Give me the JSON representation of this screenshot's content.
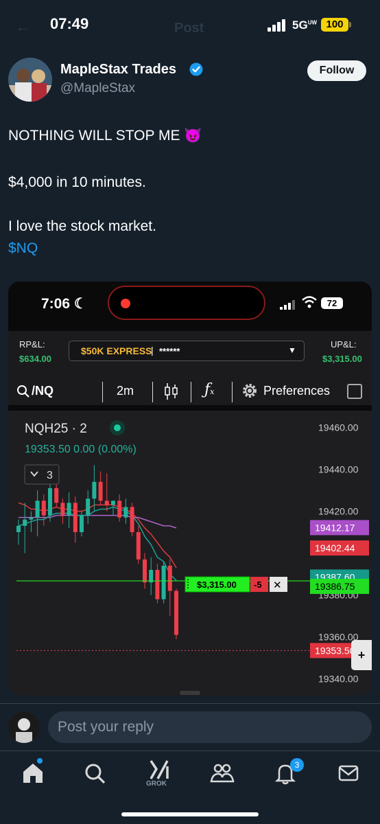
{
  "status_bar": {
    "time": "07:49",
    "network": "5G",
    "network_sup": "UW",
    "battery": "100",
    "ghost_title": "Post"
  },
  "author": {
    "name": "MapleStax Trades",
    "handle": "@MapleStax",
    "follow_label": "Follow"
  },
  "tweet": {
    "line1": "NOTHING WILL STOP ME 😈",
    "line2": "$4,000 in 10 minutes.",
    "line3": "I love the stock market.",
    "cashtag": "$NQ"
  },
  "media": {
    "status_bar": {
      "time": "7:06",
      "battery": "72"
    },
    "trade_bar": {
      "rp_label": "RP&L:",
      "rp_value": "$634.00",
      "account_name": "$50K EXPRESS",
      "account_sep": "|",
      "account_mask": "******",
      "up_label": "UP&L:",
      "up_value": "$3,315.00"
    },
    "toolbar": {
      "symbol": "/NQ",
      "interval": "2m",
      "preferences": "Preferences"
    },
    "chart": {
      "instrument": "NQH25 · 2",
      "quote": "19353.50  0.00 (0.00%)",
      "indicator_count": "3",
      "position": {
        "pnl": "$3,315.00",
        "qty": "-5",
        "close": "✕"
      },
      "plus": "+"
    }
  },
  "chart_data": {
    "type": "candlestick",
    "ylim": [
      19332,
      19468
    ],
    "y_ticks": [
      19460,
      19440,
      19420,
      19380,
      19360,
      19340
    ],
    "y_tick_labels": [
      "19460.00",
      "19440.00",
      "19420.00",
      "19380.00",
      "19360.00",
      "19340.00"
    ],
    "candles": [
      {
        "o": 19410,
        "h": 19416,
        "l": 19404,
        "c": 19413
      },
      {
        "o": 19413,
        "h": 19424,
        "l": 19400,
        "c": 19416
      },
      {
        "o": 19416,
        "h": 19420,
        "l": 19410,
        "c": 19417
      },
      {
        "o": 19417,
        "h": 19430,
        "l": 19408,
        "c": 19425
      },
      {
        "o": 19425,
        "h": 19428,
        "l": 19413,
        "c": 19418
      },
      {
        "o": 19418,
        "h": 19436,
        "l": 19415,
        "c": 19431
      },
      {
        "o": 19431,
        "h": 19435,
        "l": 19422,
        "c": 19424
      },
      {
        "o": 19424,
        "h": 19426,
        "l": 19414,
        "c": 19418
      },
      {
        "o": 19418,
        "h": 19429,
        "l": 19412,
        "c": 19424
      },
      {
        "o": 19424,
        "h": 19427,
        "l": 19405,
        "c": 19410
      },
      {
        "o": 19410,
        "h": 19420,
        "l": 19408,
        "c": 19418
      },
      {
        "o": 19418,
        "h": 19430,
        "l": 19414,
        "c": 19426
      },
      {
        "o": 19426,
        "h": 19442,
        "l": 19420,
        "c": 19434
      },
      {
        "o": 19434,
        "h": 19439,
        "l": 19423,
        "c": 19425
      },
      {
        "o": 19425,
        "h": 19438,
        "l": 19420,
        "c": 19423
      },
      {
        "o": 19423,
        "h": 19425,
        "l": 19418,
        "c": 19425
      },
      {
        "o": 19425,
        "h": 19428,
        "l": 19415,
        "c": 19417
      },
      {
        "o": 19417,
        "h": 19426,
        "l": 19414,
        "c": 19422
      },
      {
        "o": 19422,
        "h": 19424,
        "l": 19408,
        "c": 19410
      },
      {
        "o": 19410,
        "h": 19413,
        "l": 19395,
        "c": 19397
      },
      {
        "o": 19397,
        "h": 19400,
        "l": 19383,
        "c": 19386
      },
      {
        "o": 19386,
        "h": 19398,
        "l": 19380,
        "c": 19392
      },
      {
        "o": 19392,
        "h": 19395,
        "l": 19376,
        "c": 19378
      },
      {
        "o": 19378,
        "h": 19396,
        "l": 19376,
        "c": 19394
      },
      {
        "o": 19394,
        "h": 19397,
        "l": 19370,
        "c": 19382
      },
      {
        "o": 19382,
        "h": 19383,
        "l": 19359,
        "c": 19361
      }
    ],
    "ma_lines": [
      {
        "name": "",
        "color": "#e23d3d",
        "values": [
          19424,
          19423,
          19421,
          19421,
          19420,
          19421,
          19422,
          19421,
          19421,
          19420,
          19420,
          19421,
          19423,
          19423,
          19423,
          19423,
          19422,
          19421,
          19419,
          19416,
          19412,
          19409,
          19405,
          19401,
          19398,
          19393
        ]
      },
      {
        "name": "",
        "color": "#b86ad8",
        "values": [
          19417,
          19417,
          19417,
          19417,
          19417,
          19417,
          19418,
          19418,
          19418,
          19418,
          19418,
          19418,
          19418,
          19418,
          19418,
          19418,
          19418,
          19418,
          19417,
          19417,
          19416,
          19415,
          19414,
          19413,
          19413,
          19412
        ]
      },
      {
        "name": "",
        "color": "#1aa89a",
        "values": [
          19413,
          19414,
          19415,
          19416,
          19416,
          19418,
          19419,
          19419,
          19419,
          19418,
          19418,
          19418,
          19420,
          19421,
          19421,
          19422,
          19421,
          19420,
          19418,
          19414,
          19408,
          19404,
          19398,
          19396,
          19390,
          19387
        ]
      }
    ],
    "position_price": 19386.75,
    "last_price": 19353.5,
    "price_labels": [
      {
        "text": "19412.17",
        "value": 19412.17,
        "color": "#a94fc8"
      },
      {
        "text": "19402.44",
        "value": 19402.44,
        "color": "#e0343f"
      },
      {
        "text": "19387.60",
        "value": 19387.6,
        "color": "#14998a"
      },
      {
        "text": "19386.75",
        "value": 19386.75,
        "color": "#22dd22"
      },
      {
        "text": "19353.50",
        "value": 19353.5,
        "color": "#e0343f"
      }
    ]
  },
  "reply": {
    "placeholder": "Post your reply"
  },
  "bottom_nav": {
    "grok_label": "GROK",
    "notifications_count": "3"
  }
}
